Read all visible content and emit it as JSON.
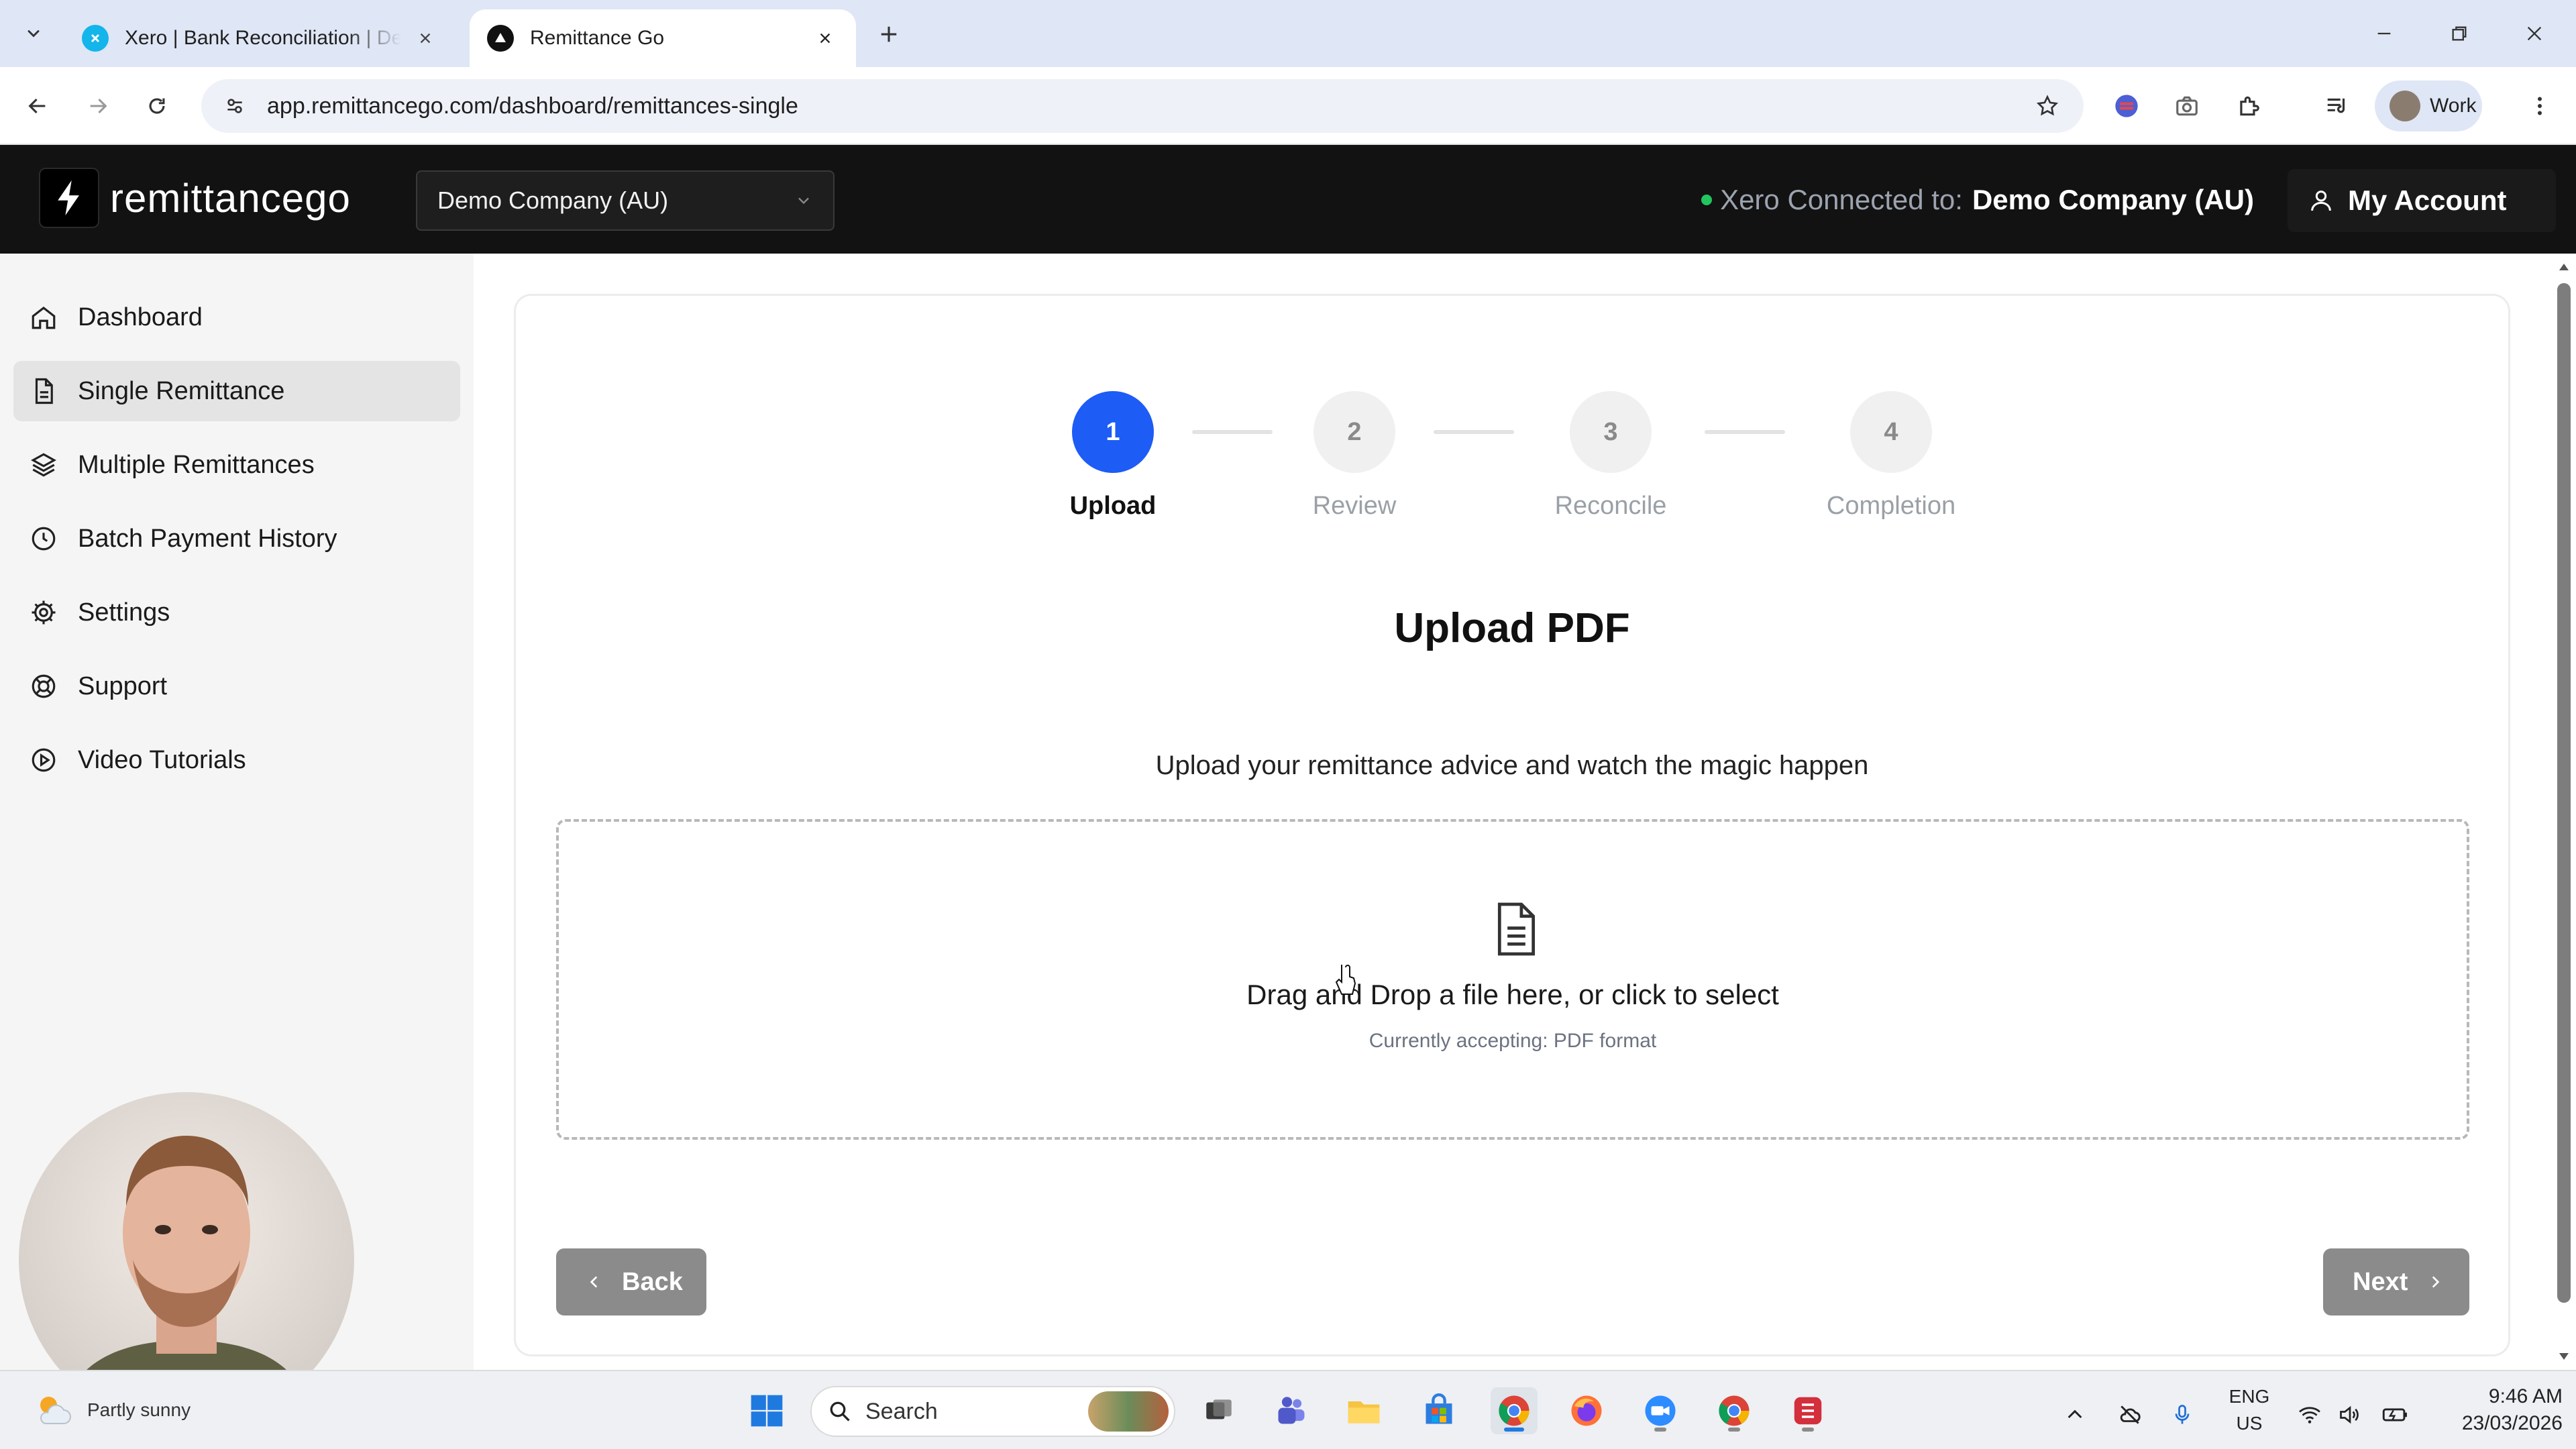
{
  "browser": {
    "tabs": [
      {
        "title": "Xero | Bank Reconciliation | Demo Company (AU)",
        "active": false
      },
      {
        "title": "Remittance Go",
        "active": true
      }
    ],
    "url": "app.remittancego.com/dashboard/remittances-single",
    "profile_label": "Work"
  },
  "header": {
    "logo_text": "remittancego",
    "company_select": "Demo Company (AU)",
    "connection_label": "Xero Connected to:",
    "connection_company": "Demo Company (AU)",
    "account_label": "My Account",
    "status_color": "#22c55e"
  },
  "sidebar": {
    "items": [
      {
        "label": "Dashboard",
        "icon": "home-icon",
        "active": false
      },
      {
        "label": "Single Remittance",
        "icon": "document-icon",
        "active": true
      },
      {
        "label": "Multiple Remittances",
        "icon": "layers-icon",
        "active": false
      },
      {
        "label": "Batch Payment History",
        "icon": "clock-icon",
        "active": false
      },
      {
        "label": "Settings",
        "icon": "gear-icon",
        "active": false
      },
      {
        "label": "Support",
        "icon": "lifebuoy-icon",
        "active": false
      },
      {
        "label": "Video Tutorials",
        "icon": "play-circle-icon",
        "active": false
      }
    ]
  },
  "stepper": {
    "steps": [
      {
        "number": "1",
        "label": "Upload",
        "state": "current"
      },
      {
        "number": "2",
        "label": "Review",
        "state": "pending"
      },
      {
        "number": "3",
        "label": "Reconcile",
        "state": "pending"
      },
      {
        "number": "4",
        "label": "Completion",
        "state": "pending"
      }
    ],
    "accent": "#1d5cf5"
  },
  "main": {
    "title": "Upload PDF",
    "subtitle": "Upload your remittance advice and watch the magic happen",
    "dropzone_text": "Drag and Drop a file here, or click to select",
    "dropzone_hint": "Currently accepting: PDF format",
    "back_label": "Back",
    "next_label": "Next"
  },
  "taskbar": {
    "weather": "Partly sunny",
    "search_placeholder": "Search",
    "lang_line1": "ENG",
    "lang_line2": "US",
    "time": "9:46 AM",
    "date": "23/03/2026"
  }
}
